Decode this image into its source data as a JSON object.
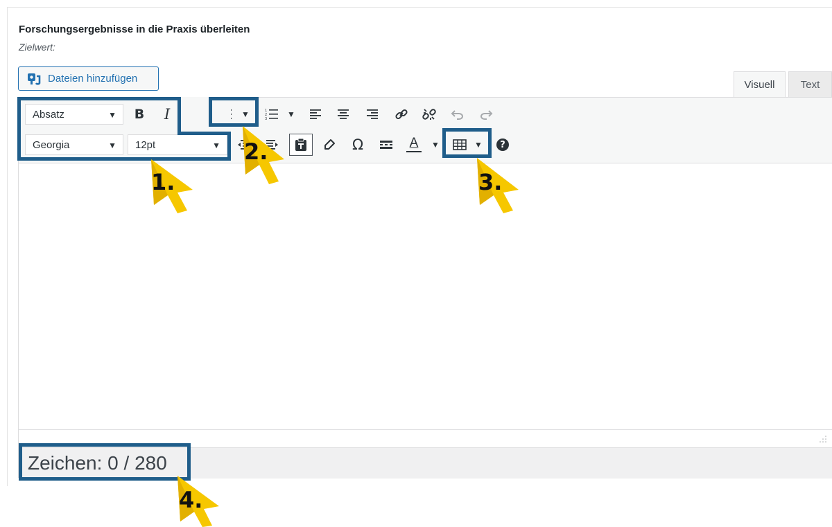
{
  "field": {
    "title": "Forschungsergebnisse in die Praxis überleiten",
    "subtitle": "Zielwert:"
  },
  "media_button": {
    "label": "Dateien hinzufügen",
    "icon": "add-media-icon"
  },
  "tabs": [
    {
      "label": "Visuell",
      "active": true
    },
    {
      "label": "Text",
      "active": false
    }
  ],
  "toolbar": {
    "format_select": {
      "value": "Absatz"
    },
    "font_family_select": {
      "value": "Georgia"
    },
    "font_size_select": {
      "value": "12pt"
    },
    "bold_label": "B",
    "italic_label": "I",
    "quote_label": "“",
    "special_char_label": "Ω",
    "text_color_label": "A",
    "help_label": "?"
  },
  "counter": {
    "text": "Zeichen: 0 / 280",
    "current": 0,
    "max": 280
  },
  "annotations": {
    "labels": [
      "1.",
      "2.",
      "3.",
      "4."
    ],
    "highlight_color": "#1f5d8a",
    "pointer_color": "#f6c700"
  }
}
